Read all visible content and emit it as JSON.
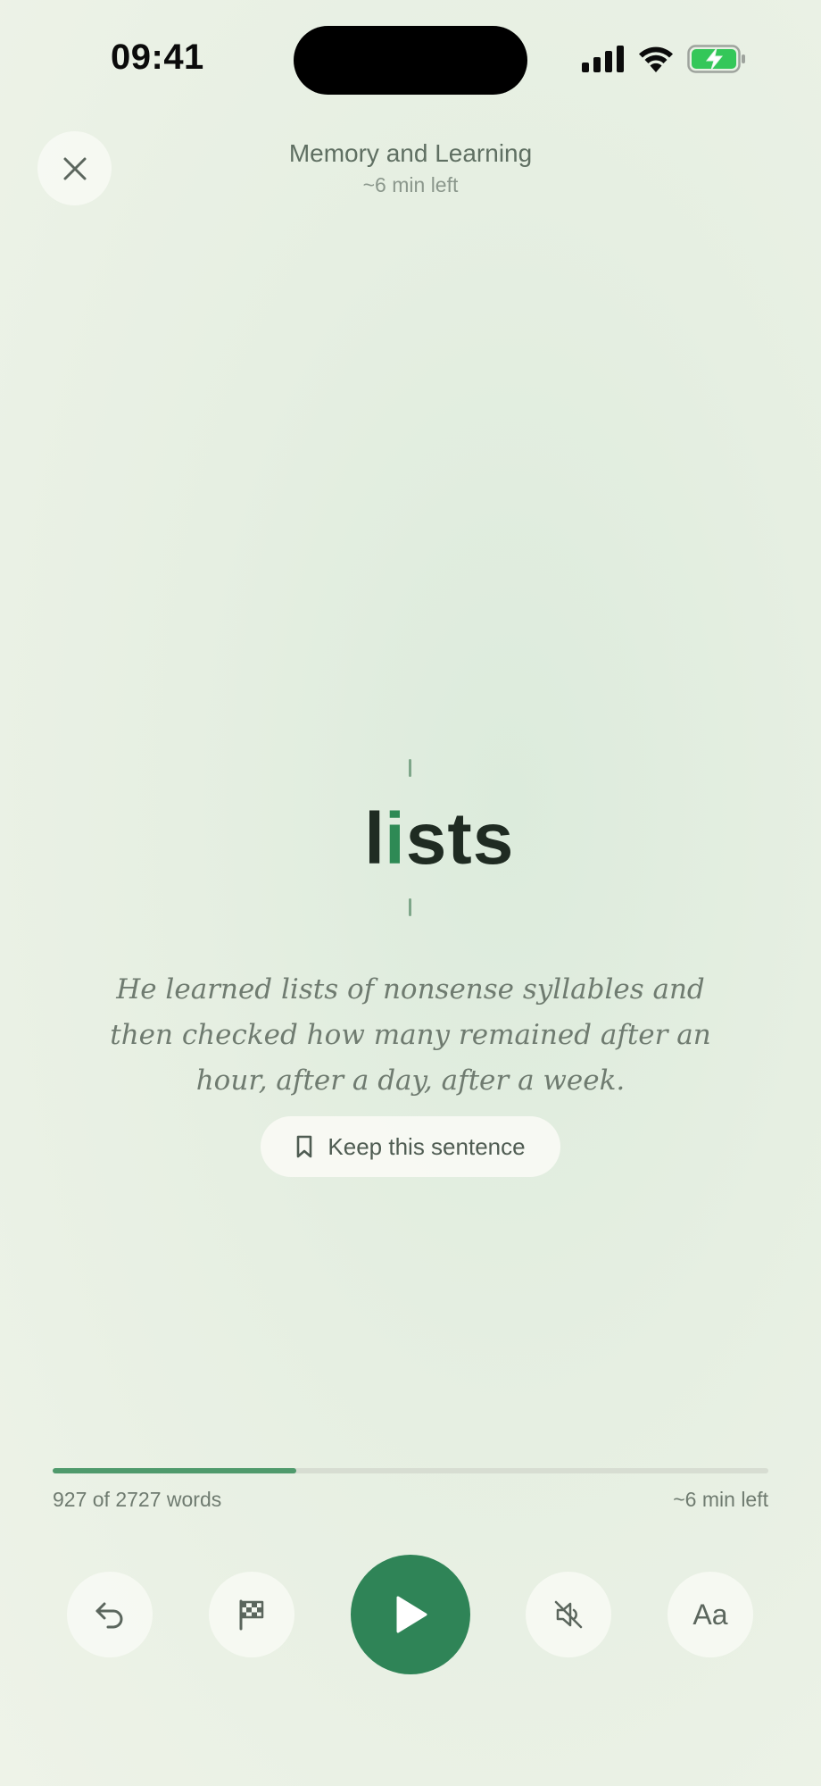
{
  "status_bar": {
    "time": "09:41"
  },
  "header": {
    "title": "Memory and Learning",
    "subtitle": "~6 min left"
  },
  "reader": {
    "word_before_focus": "l",
    "focus_letter": "i",
    "word_after_focus": "sts",
    "sentence": "He learned lists of nonsense syllables and then checked how many remained after an hour, after a day, after a week.",
    "keep_label": "Keep this sentence"
  },
  "progress": {
    "words_label": "927 of 2727 words",
    "time_left": "~6 min left",
    "words_read": 927,
    "words_total": 2727,
    "fraction": 0.34
  },
  "controls": {
    "text_size_label": "Aa"
  },
  "colors": {
    "accent": "#2f8457",
    "focus_letter": "#2e8a55",
    "battery_charging": "#34c759"
  },
  "icons": {
    "close": "close-icon",
    "rewind": "undo-icon",
    "checkpoint": "checkered-flag-icon",
    "play": "play-icon",
    "mute": "speaker-muted-icon",
    "bookmark": "bookmark-icon"
  }
}
